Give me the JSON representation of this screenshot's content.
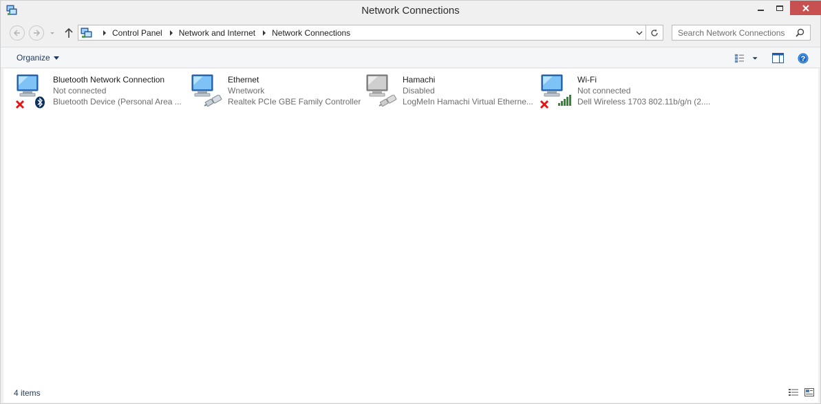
{
  "window": {
    "title": "Network Connections",
    "close_color": "#c75050"
  },
  "nav": {
    "breadcrumb": [
      "Control Panel",
      "Network and Internet",
      "Network Connections"
    ],
    "search_placeholder": "Search Network Connections"
  },
  "toolbar": {
    "organize_label": "Organize"
  },
  "items": [
    {
      "name": "Bluetooth Network Connection",
      "status": "Not connected",
      "device": "Bluetooth Device (Personal Area ...",
      "overlay": "bluetooth-icon",
      "state_icon": "red-x-icon"
    },
    {
      "name": "Ethernet",
      "status": "Wnetwork",
      "device": "Realtek PCIe GBE Family Controller",
      "overlay": "ethernet-cable-icon",
      "state_icon": ""
    },
    {
      "name": "Hamachi",
      "status": "Disabled",
      "device": "LogMeIn Hamachi Virtual Etherne...",
      "overlay": "ethernet-cable-icon",
      "state_icon": ""
    },
    {
      "name": "Wi-Fi",
      "status": "Not connected",
      "device": "Dell Wireless 1703 802.11b/g/n (2....",
      "overlay": "wifi-signal-icon",
      "state_icon": "red-x-icon"
    }
  ],
  "status": {
    "item_count": "4 items"
  }
}
